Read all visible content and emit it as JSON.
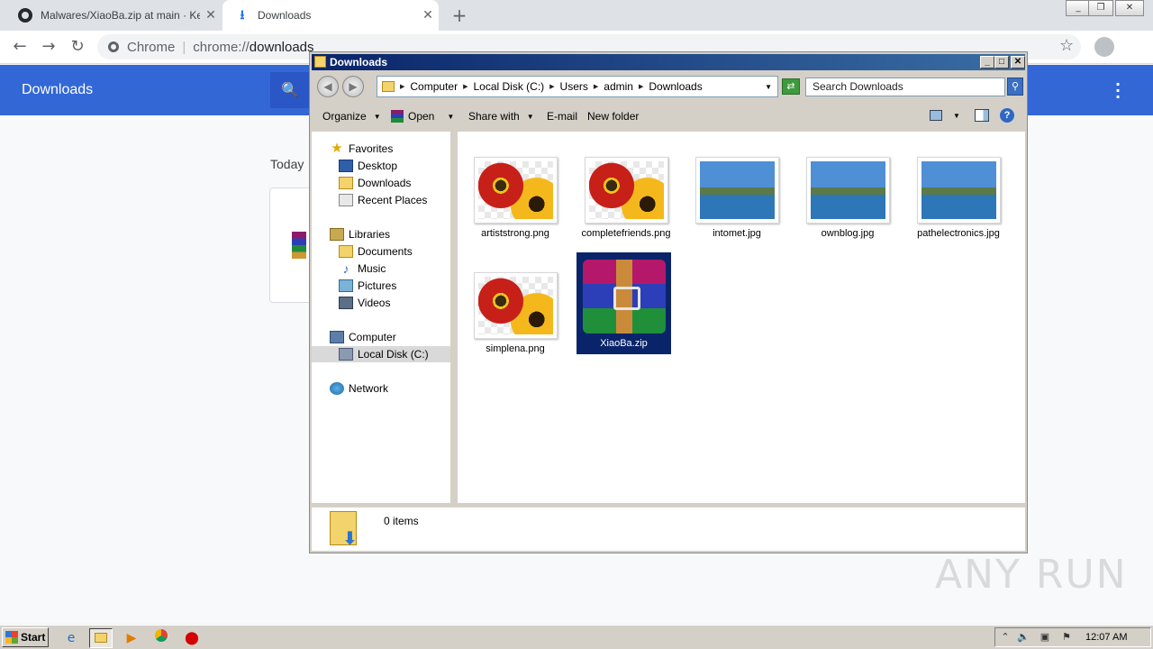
{
  "browser": {
    "tabs": [
      {
        "title": "Malwares/XiaoBa.zip at main · Kenich",
        "active": false
      },
      {
        "title": "Downloads",
        "active": true
      }
    ],
    "omnibox": {
      "scheme_label": "Chrome",
      "url_prefix": "chrome://",
      "url_host": "downloads"
    }
  },
  "downloads_page": {
    "title": "Downloads",
    "section_today": "Today"
  },
  "explorer": {
    "window_title": "Downloads",
    "breadcrumbs": [
      "Computer",
      "Local Disk (C:)",
      "Users",
      "admin",
      "Downloads"
    ],
    "search_placeholder": "Search Downloads",
    "commands": {
      "organize": "Organize",
      "open": "Open",
      "share_with": "Share with",
      "email": "E-mail",
      "new_folder": "New folder"
    },
    "nav": {
      "favorites": "Favorites",
      "desktop": "Desktop",
      "downloads": "Downloads",
      "recent_places": "Recent Places",
      "libraries": "Libraries",
      "documents": "Documents",
      "music": "Music",
      "pictures": "Pictures",
      "videos": "Videos",
      "computer": "Computer",
      "local_disk": "Local Disk (C:)",
      "network": "Network"
    },
    "files": [
      {
        "name": "artiststrong.png",
        "kind": "flower"
      },
      {
        "name": "completefriends.png",
        "kind": "flower"
      },
      {
        "name": "intomet.jpg",
        "kind": "sea"
      },
      {
        "name": "ownblog.jpg",
        "kind": "sea"
      },
      {
        "name": "pathelectronics.jpg",
        "kind": "sea"
      },
      {
        "name": "simplena.png",
        "kind": "flower"
      },
      {
        "name": "XiaoBa.zip",
        "kind": "winrar-archive",
        "selected": true
      }
    ],
    "details": {
      "item_count": "0 items"
    }
  },
  "taskbar": {
    "start_label": "Start",
    "clock": "12:07 AM"
  },
  "watermark": "ANY RUN",
  "colors": {
    "chrome_header": "#3367d6",
    "selection": "#0a246a",
    "titlebar": "#0a246a"
  }
}
